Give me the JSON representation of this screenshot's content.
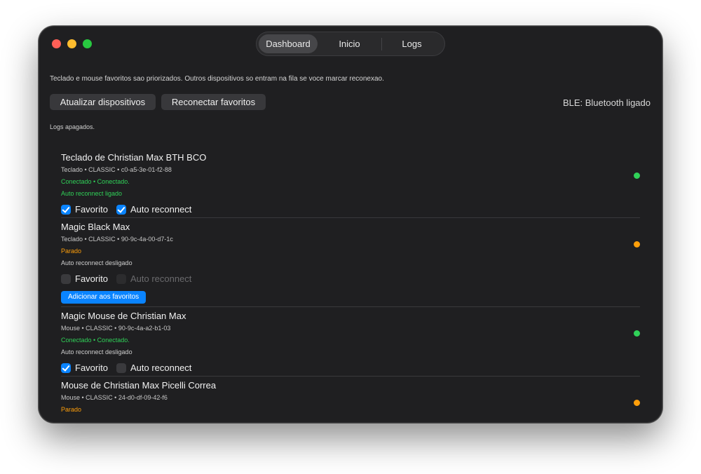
{
  "tabs": [
    {
      "label": "Dashboard",
      "active": true
    },
    {
      "label": "Inicio",
      "active": false
    },
    {
      "label": "Logs",
      "active": false
    }
  ],
  "description": "Teclado e mouse favoritos sao priorizados. Outros dispositivos so entram na fila se voce marcar reconexao.",
  "buttons": {
    "refresh": "Atualizar dispositivos",
    "reconnect": "Reconectar favoritos"
  },
  "ble_status": "BLE: Bluetooth ligado",
  "logs_status": "Logs apagados.",
  "devices": [
    {
      "name": "Teclado de Christian Max BTH BCO",
      "meta": "Teclado • CLASSIC • c0-a5-3e-01-f2-88",
      "status": "Conectado • Conectado.",
      "auto_text": "Auto reconnect ligado",
      "favorite_label": "Favorito",
      "favorite": true,
      "auto_label": "Auto reconnect",
      "auto": true,
      "indicator": "#30d158"
    },
    {
      "name": "Magic Black Max",
      "meta": "Teclado • CLASSIC • 90-9c-4a-00-d7-1c",
      "status": "Parado",
      "auto_text": "Auto reconnect desligado",
      "favorite_label": "Favorito",
      "favorite": false,
      "auto_label": "Auto reconnect",
      "auto": false,
      "auto_disabled": true,
      "add_button": "Adicionar aos favoritos",
      "indicator": "#ff9f0a"
    },
    {
      "name": "Magic Mouse de Christian Max",
      "meta": "Mouse • CLASSIC • 90-9c-4a-a2-b1-03",
      "status": "Conectado • Conectado.",
      "auto_text": "Auto reconnect desligado",
      "favorite_label": "Favorito",
      "favorite": true,
      "auto_label": "Auto reconnect",
      "auto": false,
      "indicator": "#30d158"
    },
    {
      "name": "Mouse de Christian Max Picelli Correa",
      "meta": "Mouse • CLASSIC • 24-d0-df-09-42-f6",
      "status": "Parado",
      "indicator": "#ff9f0a"
    }
  ]
}
